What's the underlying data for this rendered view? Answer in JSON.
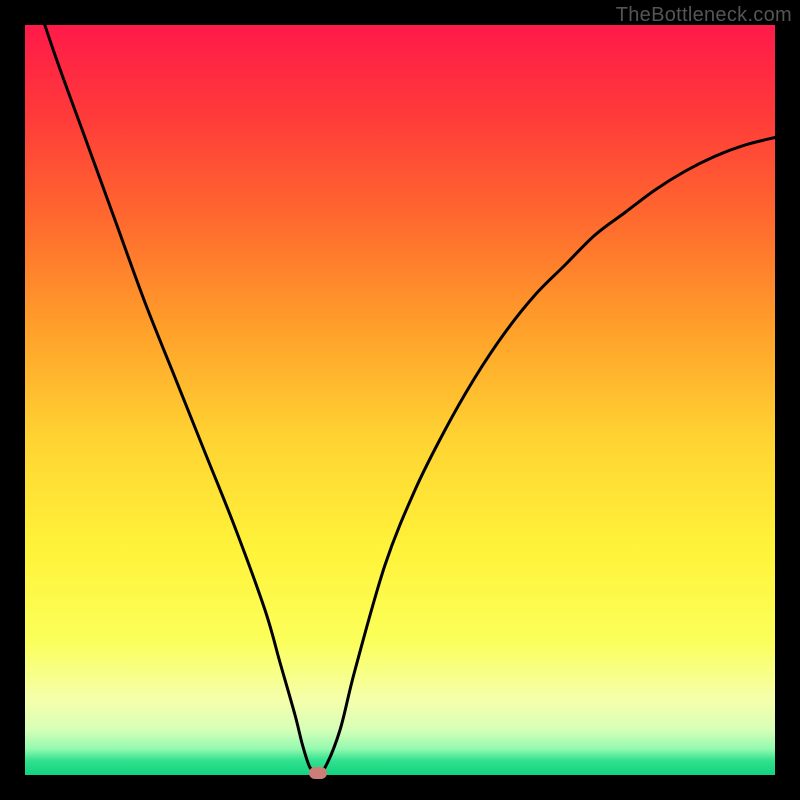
{
  "watermark": "TheBottleneck.com",
  "chart_data": {
    "type": "line",
    "title": "",
    "xlabel": "",
    "ylabel": "",
    "xlim": [
      0,
      100
    ],
    "ylim": [
      0,
      100
    ],
    "x": [
      0,
      4,
      8,
      12,
      16,
      20,
      24,
      28,
      32,
      34,
      36,
      37,
      38,
      39,
      40,
      42,
      44,
      48,
      52,
      56,
      60,
      64,
      68,
      72,
      76,
      80,
      84,
      88,
      92,
      96,
      100
    ],
    "values": [
      108,
      96,
      85,
      74,
      63,
      53,
      43,
      33,
      22,
      15,
      8,
      4,
      1,
      0.5,
      1,
      6,
      14,
      28,
      38,
      46,
      53,
      59,
      64,
      68,
      72,
      75,
      78,
      80.5,
      82.5,
      84,
      85
    ],
    "grid": false,
    "legend": false,
    "marker": {
      "x": 39,
      "y": 0
    }
  },
  "colors": {
    "curve": "#000000",
    "marker": "#cd7d78",
    "background_top": "#ff1a4a",
    "background_bottom": "#11d37e",
    "frame": "#000000"
  }
}
